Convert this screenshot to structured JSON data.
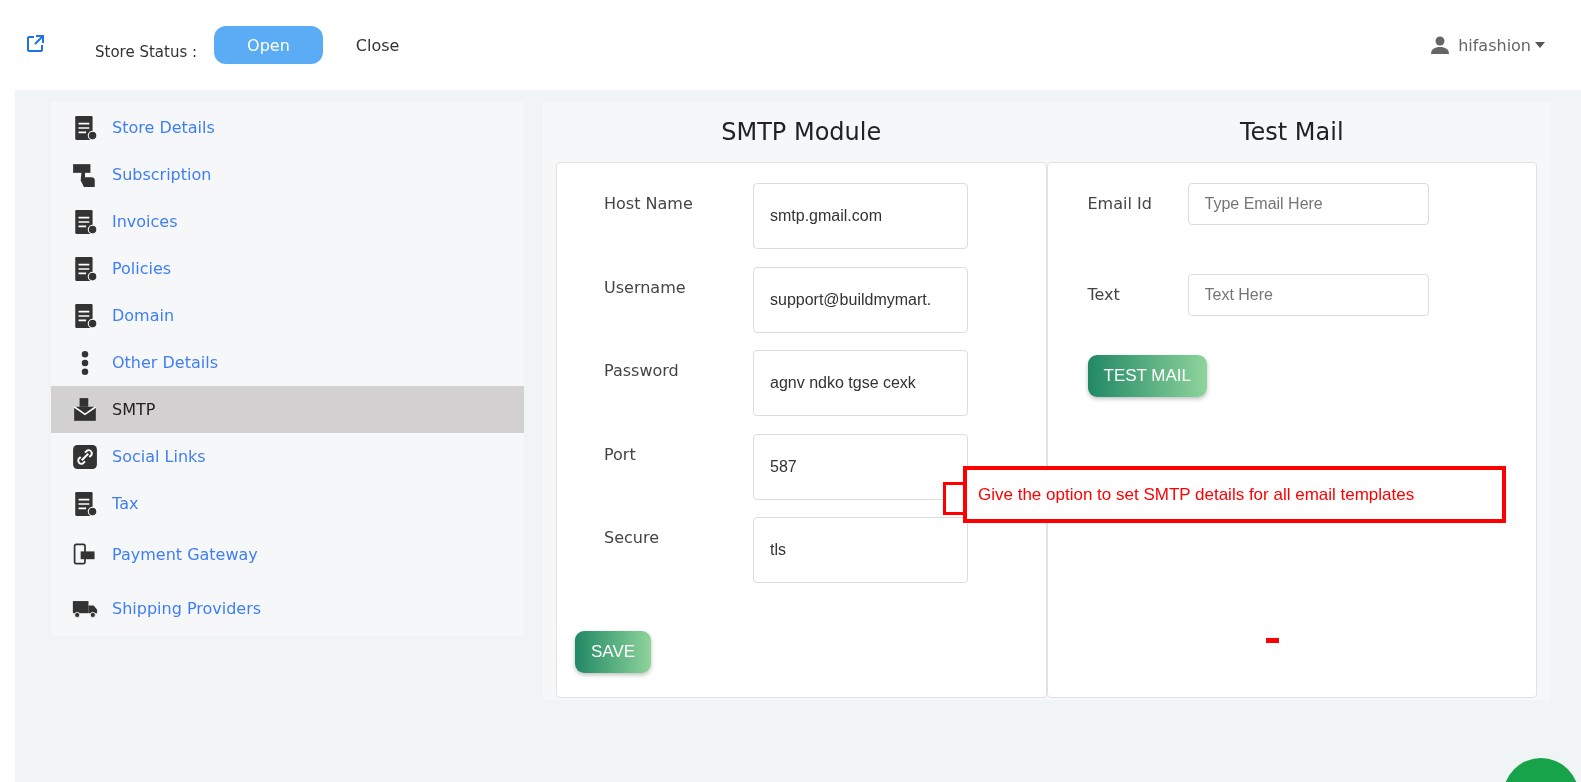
{
  "header": {
    "store_status_label": "Store Status :",
    "status_options": [
      {
        "label": "Open",
        "selected": true
      },
      {
        "label": "Close",
        "selected": false
      }
    ],
    "user": "hifashion"
  },
  "sidebar": {
    "items": [
      {
        "label": "Store Details",
        "selected": false
      },
      {
        "label": "Subscription",
        "selected": false
      },
      {
        "label": "Invoices",
        "selected": false
      },
      {
        "label": "Policies",
        "selected": false
      },
      {
        "label": "Domain",
        "selected": false
      },
      {
        "label": "Other Details",
        "selected": false
      },
      {
        "label": "SMTP",
        "selected": true
      },
      {
        "label": "Social Links",
        "selected": false
      },
      {
        "label": "Tax",
        "selected": false
      },
      {
        "label": "Payment Gateway",
        "selected": false
      },
      {
        "label": "Shipping Providers",
        "selected": false
      }
    ]
  },
  "smtp": {
    "title": "SMTP Module",
    "fields": [
      {
        "label": "Host Name",
        "value": "smtp.gmail.com"
      },
      {
        "label": "Username",
        "value": "support@buildmymart."
      },
      {
        "label": "Password",
        "value": "agnv ndko tgse cexk"
      },
      {
        "label": "Port",
        "value": "587"
      },
      {
        "label": "Secure",
        "value": "tls"
      }
    ],
    "button": "SAVE"
  },
  "test_mail": {
    "title": "Test Mail",
    "fields": [
      {
        "label": "Email Id",
        "placeholder": "Type Email Here"
      },
      {
        "label": "Text",
        "placeholder": "Text Here"
      }
    ],
    "button": "TEST MAIL"
  },
  "annotation": {
    "text": "Give the option to set SMTP details for all email templates"
  }
}
